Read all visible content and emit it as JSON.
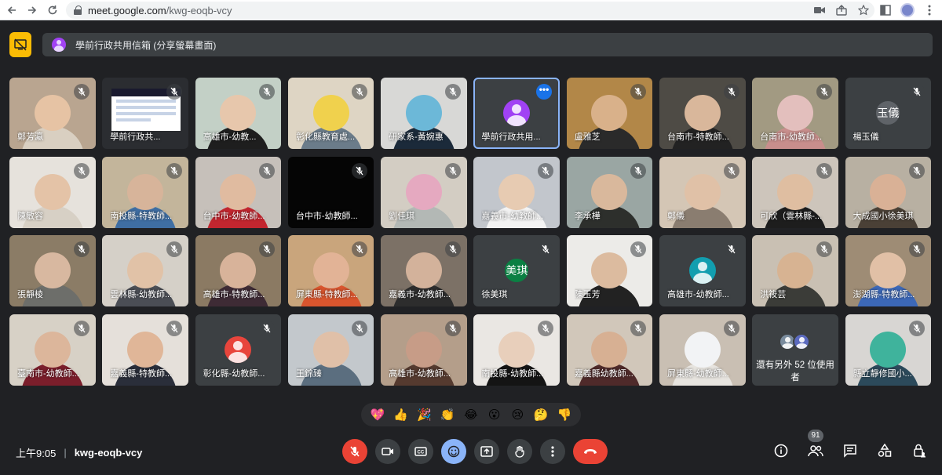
{
  "browser": {
    "url_host": "meet.google.com",
    "url_path": "/kwg-eoqb-vcy",
    "icons": [
      "back-icon",
      "forward-icon",
      "reload-icon",
      "camera-icon",
      "share-icon",
      "star-icon",
      "sidebar-icon",
      "profile-icon",
      "menu-icon"
    ]
  },
  "presentation": {
    "label": "學前行政共用信箱 (分享螢幕畫面)"
  },
  "tiles": [
    {
      "name": "鄭芳瀛",
      "bg": "#b9a590",
      "face": "#e6c3a4",
      "body": "#d9cfc1"
    },
    {
      "name": "學前行政共...",
      "type": "screen",
      "bg": "#2b2d31"
    },
    {
      "name": "高雄市-幼教...",
      "bg": "#c3d0c6",
      "face": "#e7c7ac",
      "body": "#1e1e1e"
    },
    {
      "name": "彰化縣教育處...",
      "bg": "#ded5c4",
      "face": "#f0d14d",
      "body": "#6b7c8a"
    },
    {
      "name": "研家系-黃婉惠",
      "bg": "#d8d8d6",
      "face": "#6cb8d8",
      "body": "#1b2a3a"
    },
    {
      "name": "學前行政共用...",
      "type": "avatar",
      "avcolor": "#a142f4",
      "bg": "#3c4043",
      "active": true
    },
    {
      "name": "盧雅芝",
      "bg": "#b28748",
      "face": "#d9b18a",
      "body": "#2a2a2a"
    },
    {
      "name": "台南市-特教師...",
      "bg": "#4e4b45",
      "face": "#d9b79b",
      "body": "#222"
    },
    {
      "name": "台南市-幼教師...",
      "bg": "#a29a82",
      "face": "#e3bfbd",
      "body": "#c88e8c"
    },
    {
      "name": "楊玉儀",
      "type": "letter",
      "letter": "玉儀",
      "avcolor": "#5f6368",
      "bg": "#3c4043"
    },
    {
      "name": "陳敏容",
      "bg": "#e6e2dc",
      "face": "#e4c3a7",
      "body": "#d7d0c5"
    },
    {
      "name": "南投縣-特教師...",
      "bg": "#c3b59b",
      "face": "#d7b49a",
      "body": "#3f6ea3"
    },
    {
      "name": "台中市-幼教師...",
      "bg": "#c6c0ba",
      "face": "#e0bba0",
      "body": "#c2262f"
    },
    {
      "name": "台中市-幼教師...",
      "type": "dark",
      "bg": "#050505"
    },
    {
      "name": "劉佳琪",
      "bg": "#d3cdc3",
      "face": "#e5a9c0",
      "body": "#b3b8b5"
    },
    {
      "name": "嘉義市-幼教師...",
      "bg": "#c2c6cc",
      "face": "#e7cbb2",
      "body": "#f3f3f3"
    },
    {
      "name": "李承樺",
      "bg": "#9aa6a3",
      "face": "#d9b89c",
      "body": "#2d2f2c"
    },
    {
      "name": "鄭儀",
      "bg": "#d4c6b5",
      "face": "#e0c1a7",
      "body": "#8a7d70"
    },
    {
      "name": "可欣（雲林縣-...",
      "bg": "#cdc5bb",
      "face": "#dfbea1",
      "body": "#1d1d1d"
    },
    {
      "name": "大成國小徐美琪",
      "bg": "#b8b0a2",
      "face": "#d9b196",
      "body": "#4a4036"
    },
    {
      "name": "張靜棱",
      "bg": "#8b7c66",
      "face": "#d8b8a0",
      "body": "#6d6e6a"
    },
    {
      "name": "雲林縣-幼教師...",
      "bg": "#d5d0c8",
      "face": "#e1c2a7",
      "body": "#4b4e55"
    },
    {
      "name": "高雄市-特教師...",
      "bg": "#8b7a63",
      "face": "#d8b39a",
      "body": "#3e2b35"
    },
    {
      "name": "屏東縣-特教師...",
      "bg": "#c9a57c",
      "face": "#e2b396",
      "body": "#d9552e"
    },
    {
      "name": "嘉義市-幼教師...",
      "bg": "#7c7166",
      "face": "#d3b29b",
      "body": "#2d2d2d"
    },
    {
      "name": "徐美琪",
      "type": "letter",
      "letter": "美琪",
      "avcolor": "#0b8043",
      "bg": "#3c4043"
    },
    {
      "name": "陳玉芳",
      "bg": "#ecebe8",
      "face": "#dcbb9f",
      "body": "#222"
    },
    {
      "name": "高雄市-幼教師...",
      "type": "avatar",
      "avcolor": "#129eaf",
      "bg": "#3c4043"
    },
    {
      "name": "洪筱芸",
      "bg": "#c9c0b3",
      "face": "#d7b392",
      "body": "#3b3c38"
    },
    {
      "name": "澎湖縣-特教師...",
      "bg": "#9e8c75",
      "face": "#e1c0a6",
      "body": "#3c68b8"
    },
    {
      "name": "臺南市-幼教師...",
      "bg": "#d7d1c6",
      "face": "#dcb69b",
      "body": "#7b1e2b"
    },
    {
      "name": "嘉義縣-特教師...",
      "bg": "#e5e0da",
      "face": "#e0b698",
      "body": "#2a2e3a"
    },
    {
      "name": "彰化縣-幼教師...",
      "type": "avatar",
      "avcolor": "#e8453c",
      "bg": "#3c4043"
    },
    {
      "name": "王錦臻",
      "bg": "#c3c8cc",
      "face": "#e0c0a8",
      "body": "#5b6e7f"
    },
    {
      "name": "高雄市-幼教師...",
      "bg": "#b49e8a",
      "face": "#c79c87",
      "body": "#553a2f"
    },
    {
      "name": "南投縣-幼教師...",
      "bg": "#eae7e3",
      "face": "#e8cfbb",
      "body": "#141414"
    },
    {
      "name": "嘉義縣幼教師...",
      "bg": "#d1c7ba",
      "face": "#d7b093",
      "body": "#4f2a2a"
    },
    {
      "name": "屏東縣-幼教師...",
      "bg": "#c9bfb3",
      "face": "#f2f3f5",
      "body": "#e7e4df"
    },
    {
      "name": "還有另外 52 位使用者",
      "type": "more",
      "bg": "#3c4043"
    },
    {
      "name": "縣立靜修國小...",
      "bg": "#d8d6d3",
      "face": "#3fb39c",
      "body": "#2c4a5b"
    }
  ],
  "reactions": [
    "💖",
    "👍",
    "🎉",
    "👏",
    "😂",
    "😮",
    "😢",
    "🤔",
    "👎"
  ],
  "meeting": {
    "time": "上午9:05",
    "code": "kwg-eoqb-vcy"
  },
  "participants_count": "91",
  "colors": {
    "background": "#202124",
    "tile": "#3c4043",
    "accent_yellow": "#fbbc04",
    "end_red": "#ea4335",
    "active_blue": "#8ab4f8"
  }
}
